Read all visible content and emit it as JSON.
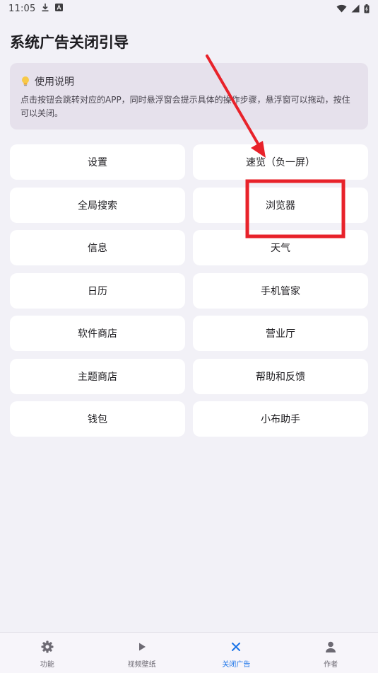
{
  "status_bar": {
    "time": "11:05",
    "left_icons": [
      "download-icon",
      "a-box-icon"
    ],
    "right_icons": [
      "wifi-icon",
      "signal-icon",
      "battery-icon"
    ]
  },
  "page": {
    "title": "系统广告关闭引导"
  },
  "info": {
    "icon": "lightbulb-icon",
    "title": "使用说明",
    "body": "点击按钮会跳转对应的APP，同时悬浮窗会提示具体的操作步骤，悬浮窗可以拖动，按住可以关闭。"
  },
  "buttons": [
    {
      "label": "设置"
    },
    {
      "label": "速览（负一屏）"
    },
    {
      "label": "全局搜索"
    },
    {
      "label": "浏览器"
    },
    {
      "label": "信息"
    },
    {
      "label": "天气"
    },
    {
      "label": "日历"
    },
    {
      "label": "手机管家"
    },
    {
      "label": "软件商店"
    },
    {
      "label": "营业厅"
    },
    {
      "label": "主题商店"
    },
    {
      "label": "帮助和反馈"
    },
    {
      "label": "钱包"
    },
    {
      "label": "小布助手"
    }
  ],
  "annotation": {
    "color": "#e8222a",
    "arrow_target": "速览（负一屏）",
    "highlight_target": "浏览器"
  },
  "bottom_nav": {
    "active": "关闭广告",
    "active_color": "#1a73e8",
    "items": [
      {
        "label": "功能",
        "icon": "gear-icon"
      },
      {
        "label": "视频壁纸",
        "icon": "play-icon"
      },
      {
        "label": "关闭广告",
        "icon": "close-icon"
      },
      {
        "label": "作者",
        "icon": "person-icon"
      }
    ]
  }
}
